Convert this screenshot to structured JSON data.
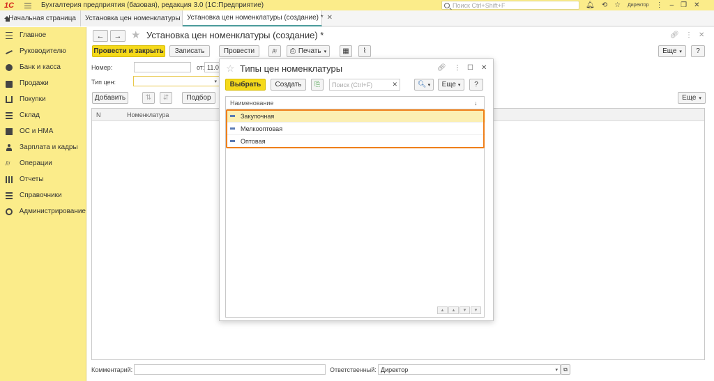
{
  "app": {
    "logo": "1С",
    "title": "Бухгалтерия предприятия (базовая), редакция 3.0  (1С:Предприятие)",
    "search_placeholder": "Поиск Ctrl+Shift+F",
    "user": "Директор"
  },
  "tabs": [
    {
      "label": "Начальная страница"
    },
    {
      "label": "Установка цен номенклатуры"
    },
    {
      "label": "Установка цен номенклатуры (создание) *"
    }
  ],
  "sidebar": {
    "items": [
      {
        "label": "Главное",
        "icon": "menu-icon"
      },
      {
        "label": "Руководителю",
        "icon": "chart-icon"
      },
      {
        "label": "Банк и касса",
        "icon": "bank-icon"
      },
      {
        "label": "Продажи",
        "icon": "bag-icon"
      },
      {
        "label": "Покупки",
        "icon": "cart-icon"
      },
      {
        "label": "Склад",
        "icon": "warehouse-icon"
      },
      {
        "label": "ОС и НМА",
        "icon": "truck-icon"
      },
      {
        "label": "Зарплата и кадры",
        "icon": "person-icon"
      },
      {
        "label": "Операции",
        "icon": "operations-icon"
      },
      {
        "label": "Отчеты",
        "icon": "reports-icon"
      },
      {
        "label": "Справочники",
        "icon": "catalog-icon"
      },
      {
        "label": "Администрирование",
        "icon": "gear-icon"
      }
    ]
  },
  "document": {
    "title": "Установка цен номенклатуры (создание) *",
    "toolbar": {
      "post_close": "Провести и закрыть",
      "save": "Записать",
      "post": "Провести",
      "print": "Печать",
      "more": "Еще"
    },
    "fields": {
      "number_label": "Номер:",
      "number_value": "",
      "date_label": "от:",
      "date_value": "11.0",
      "price_type_label": "Тип цен:",
      "price_type_value": ""
    },
    "table_toolbar": {
      "add": "Добавить",
      "select": "Подбор",
      "more": "Еще"
    },
    "table": {
      "columns": [
        "N",
        "Номенклатура"
      ]
    },
    "footer": {
      "comment_label": "Комментарий:",
      "comment_value": "",
      "responsible_label": "Ответственный:",
      "responsible_value": "Директор"
    }
  },
  "modal": {
    "title": "Типы цен номенклатуры",
    "select": "Выбрать",
    "create": "Создать",
    "search_placeholder": "Поиск (Ctrl+F)",
    "more": "Еще",
    "help": "?",
    "column": "Наименование",
    "rows": [
      {
        "label": "Закупочная"
      },
      {
        "label": "Мелкооптовая"
      },
      {
        "label": "Оптовая"
      }
    ]
  },
  "colors": {
    "accent_yellow": "#fbec8a",
    "button_yellow": "#f5d91a",
    "highlight_orange": "#ef7f1a",
    "active_tab_line": "#4a9b9b"
  }
}
